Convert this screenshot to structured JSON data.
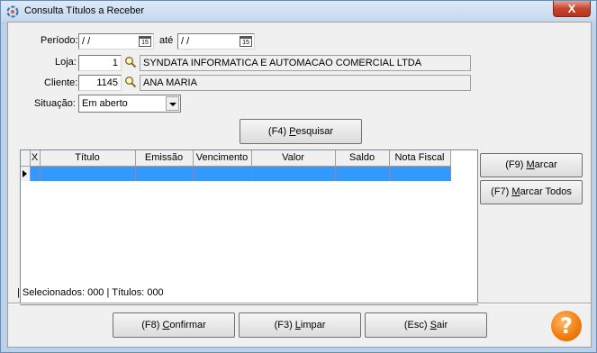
{
  "window": {
    "title": "Consulta Títulos a Receber",
    "close_glyph": "X"
  },
  "filters": {
    "periodo_label": "Período:",
    "periodo_from": " /  /",
    "ate_label": "até",
    "periodo_to": " /  /",
    "calendar_text": "15",
    "loja_label": "Loja:",
    "loja_code": "1",
    "loja_name": "SYNDATA INFORMATICA E AUTOMACAO COMERCIAL LTDA",
    "cliente_label": "Cliente:",
    "cliente_code": "1145",
    "cliente_name": "ANA MARIA",
    "situacao_label": "Situação:",
    "situacao_value": "Em aberto"
  },
  "buttons": {
    "pesquisar": {
      "prefix": "(F4) ",
      "mnemonic": "P",
      "rest": "esquisar"
    },
    "marcar": {
      "prefix": "(F9) ",
      "mnemonic": "M",
      "rest": "arcar"
    },
    "marcar_todos": {
      "prefix": "(F7) ",
      "mnemonic": "M",
      "rest": "arcar Todos"
    },
    "confirmar": {
      "prefix": "(F8) ",
      "mnemonic": "C",
      "rest": "onfirmar"
    },
    "limpar": {
      "prefix": "(F3) ",
      "mnemonic": "L",
      "rest": "impar"
    },
    "sair": {
      "prefix": "(Esc) ",
      "mnemonic": "S",
      "rest": "air"
    }
  },
  "grid": {
    "columns": [
      "X",
      "Título",
      "Emissão",
      "Vencimento",
      "Valor",
      "Saldo",
      "Nota Fiscal"
    ]
  },
  "status": {
    "text": "| Selecionados: 000  | Títulos: 000"
  },
  "help": {
    "glyph": "?"
  },
  "colors": {
    "selection": "#3399ff",
    "help_orange": "#f07b0c",
    "window_frame": "#b9d1ea"
  }
}
